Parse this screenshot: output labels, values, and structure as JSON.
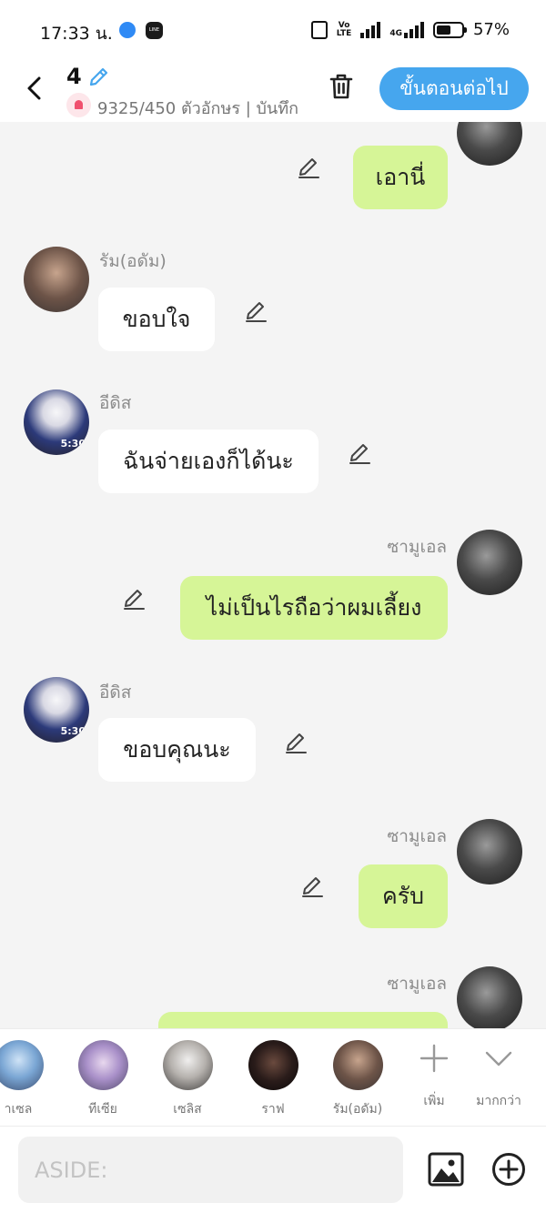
{
  "status_bar": {
    "time": "17:33 น.",
    "volte_top": "Vo",
    "volte_bottom": "LTE",
    "network": "4G",
    "battery_text": "57%",
    "battery_level": 0.57,
    "apps": [
      "messenger-icon",
      "line-icon"
    ],
    "line_label": "LINE"
  },
  "header": {
    "episode": "4",
    "counter": "9325/450 ตัวอักษร | บันทึก",
    "next_button": "ขั้นตอนต่อไป",
    "accent": "#46a6ee"
  },
  "messages": [
    {
      "side": "right",
      "name": "",
      "text": "เอานี่"
    },
    {
      "side": "left",
      "name": "รัม(อดัม)",
      "text": "ขอบใจ"
    },
    {
      "side": "left",
      "name": "อีดิส",
      "text": "ฉันจ่ายเองก็ได้นะ",
      "avatar_badge": "5:30"
    },
    {
      "side": "right",
      "name": "ซามูเอล",
      "text": "ไม่เป็นไรถือว่าผมเลี้ยง"
    },
    {
      "side": "left",
      "name": "อีดิส",
      "text": "ขอบคุณนะ",
      "avatar_badge": "5:30"
    },
    {
      "side": "right",
      "name": "ซามูเอล",
      "text": "ครับ"
    },
    {
      "side": "right",
      "name": "ซามูเอล",
      "text": ""
    }
  ],
  "colors": {
    "right_bubble": "#d6f597",
    "left_bubble": "#ffffff",
    "background": "#f4f4f4"
  },
  "characters": [
    {
      "name": "าเซล"
    },
    {
      "name": "ทีเซีย"
    },
    {
      "name": "เซลิส"
    },
    {
      "name": "ราฟ"
    },
    {
      "name": "รัม(อดัม)"
    }
  ],
  "char_controls": {
    "add_label": "เพิ่ม",
    "more_label": "มากกว่า"
  },
  "input": {
    "placeholder": "ASIDE:"
  }
}
